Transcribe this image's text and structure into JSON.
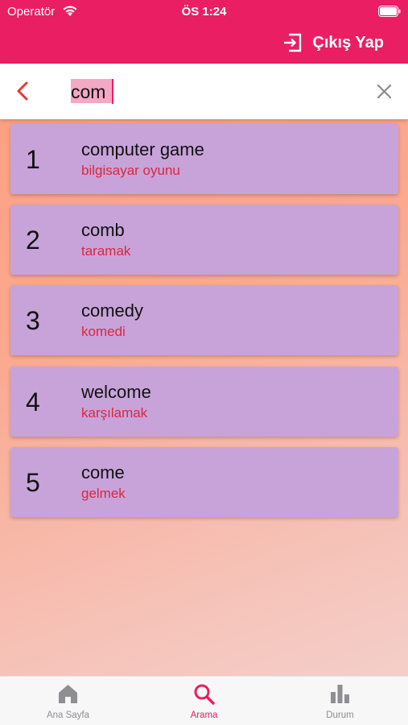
{
  "status_bar": {
    "carrier": "Operatör",
    "time": "ÖS 1:24"
  },
  "header": {
    "logout_label": "Çıkış Yap"
  },
  "search": {
    "query": "com"
  },
  "results": [
    {
      "index": "1",
      "word": "computer game",
      "translation": "bilgisayar oyunu"
    },
    {
      "index": "2",
      "word": "comb",
      "translation": "taramak"
    },
    {
      "index": "3",
      "word": "comedy",
      "translation": "komedi"
    },
    {
      "index": "4",
      "word": "welcome",
      "translation": "karşılamak"
    },
    {
      "index": "5",
      "word": "come",
      "translation": "gelmek"
    }
  ],
  "tabs": [
    {
      "label": "Ana Sayfa",
      "icon": "home-icon"
    },
    {
      "label": "Arama",
      "icon": "search-icon",
      "active": true
    },
    {
      "label": "Durum",
      "icon": "bar-chart-icon"
    }
  ],
  "colors": {
    "primary": "#e91e63",
    "card": "#c8a3da",
    "translation": "#d8283e"
  }
}
